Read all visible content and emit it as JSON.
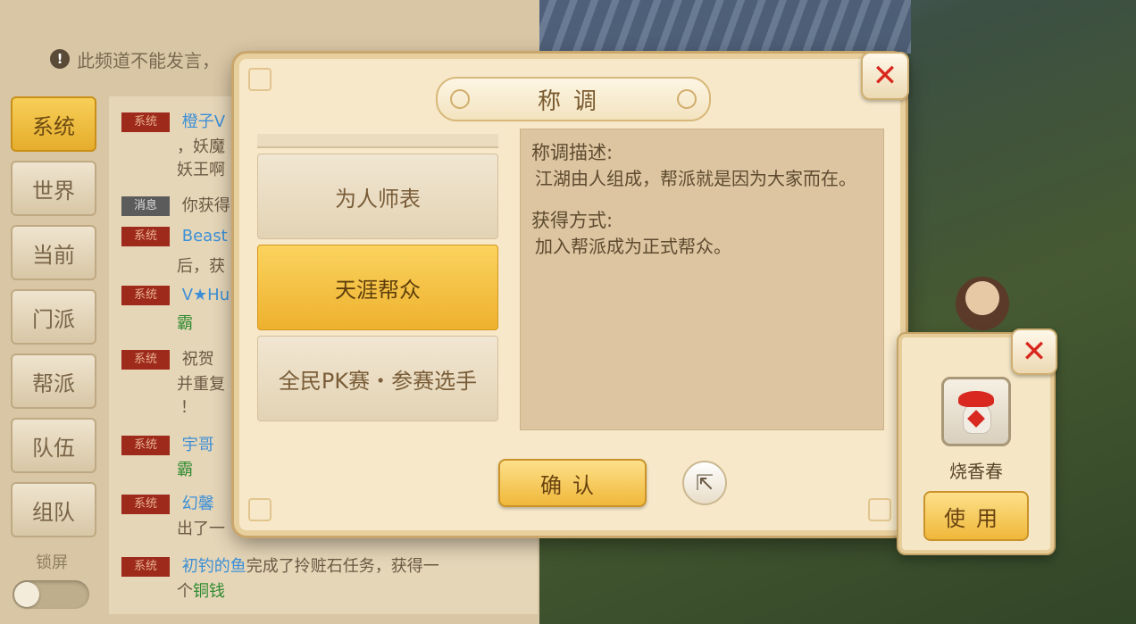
{
  "chat": {
    "notice": "此频道不能发言，",
    "channels": [
      "系统",
      "世界",
      "当前",
      "门派",
      "帮派",
      "队伍",
      "组队"
    ],
    "active_channel": "系统",
    "lock_label": "锁屏",
    "messages": [
      {
        "tag": "系统",
        "line1_name": "橙子V",
        "line2": "，妖魔",
        "line3": "妖王啊"
      },
      {
        "tag": "消息",
        "text": "你获得"
      },
      {
        "tag": "系统",
        "name": "Beast",
        "line2": "后，获"
      },
      {
        "tag": "系统",
        "name": "V★Hu",
        "line2": "霸"
      },
      {
        "tag": "系统",
        "text": "祝贺",
        "line2": "并重复",
        "line3": "！"
      },
      {
        "tag": "系统",
        "name": "宇哥",
        "line2": "霸"
      },
      {
        "tag": "系统",
        "name": "幻馨",
        "line2": "出了一"
      },
      {
        "tag": "系统",
        "name": "初钓的鱼",
        "text": "完成了拎赃石任务，获得一",
        "line2_prefix": "个",
        "line2_green": "铜钱"
      }
    ]
  },
  "dialog": {
    "title": "称调",
    "titles": [
      "为人师表",
      "天涯帮众",
      "全民PK赛・参赛选手"
    ],
    "selected": "天涯帮众",
    "desc_header": "称调描述:",
    "desc_body": "江湖由人组成，帮派就是因为大家而在。",
    "obtain_header": "获得方式:",
    "obtain_body": "加入帮派成为正式帮众。",
    "confirm_label": "确认"
  },
  "item_popup": {
    "item_name": "烧香春",
    "use_label": "使用"
  },
  "icons": {
    "close": "close-x-icon",
    "share": "share-export-icon",
    "notice": "info-icon"
  },
  "colors": {
    "accent_gold": "#f0b83a",
    "close_red": "#d8261c",
    "tag_red": "#9e2a1c"
  }
}
